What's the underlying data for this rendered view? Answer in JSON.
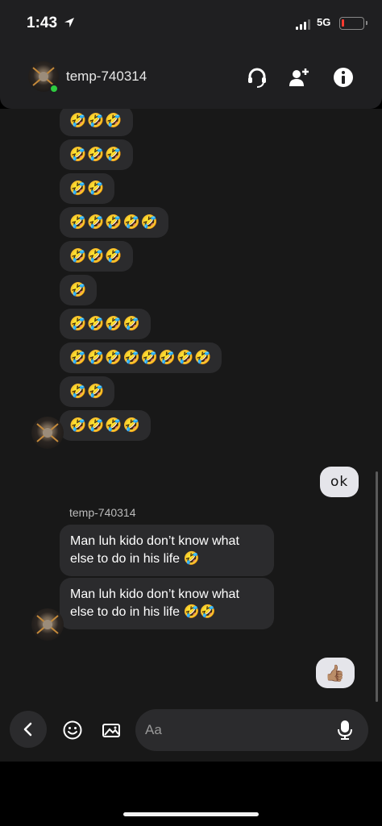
{
  "status_bar": {
    "time": "1:43",
    "network": "5G"
  },
  "header": {
    "username": "temp-740314"
  },
  "icons": {
    "location": "location-arrow-icon",
    "call": "headset-icon",
    "add_user": "add-user-icon",
    "info": "info-icon",
    "emoji": "emoji-icon",
    "gallery": "image-icon",
    "mic": "microphone-icon",
    "back": "chevron-left-icon"
  },
  "messages": {
    "emoji_bursts": [
      "🤣🤣🤣",
      "🤣🤣🤣",
      "🤣🤣",
      "🤣🤣🤣🤣🤣",
      "🤣🤣🤣",
      "🤣",
      "🤣🤣🤣🤣",
      "🤣🤣🤣🤣🤣🤣🤣🤣",
      "🤣🤣",
      "🤣🤣🤣🤣"
    ],
    "my_reply": "ok",
    "sender_label": "temp-740314",
    "text_1": "Man luh kido don’t know what else to do in his life 🤣",
    "text_2": "Man luh kido don’t know what else to do in his life 🤣🤣",
    "my_reaction": "👍🏽"
  },
  "composer": {
    "placeholder": "Aa"
  },
  "colors": {
    "background": "#181818",
    "bubble": "#2b2b2d",
    "mine_bubble": "#e5e5ea",
    "online": "#2ecc40",
    "battery_low": "#ff3b30"
  }
}
